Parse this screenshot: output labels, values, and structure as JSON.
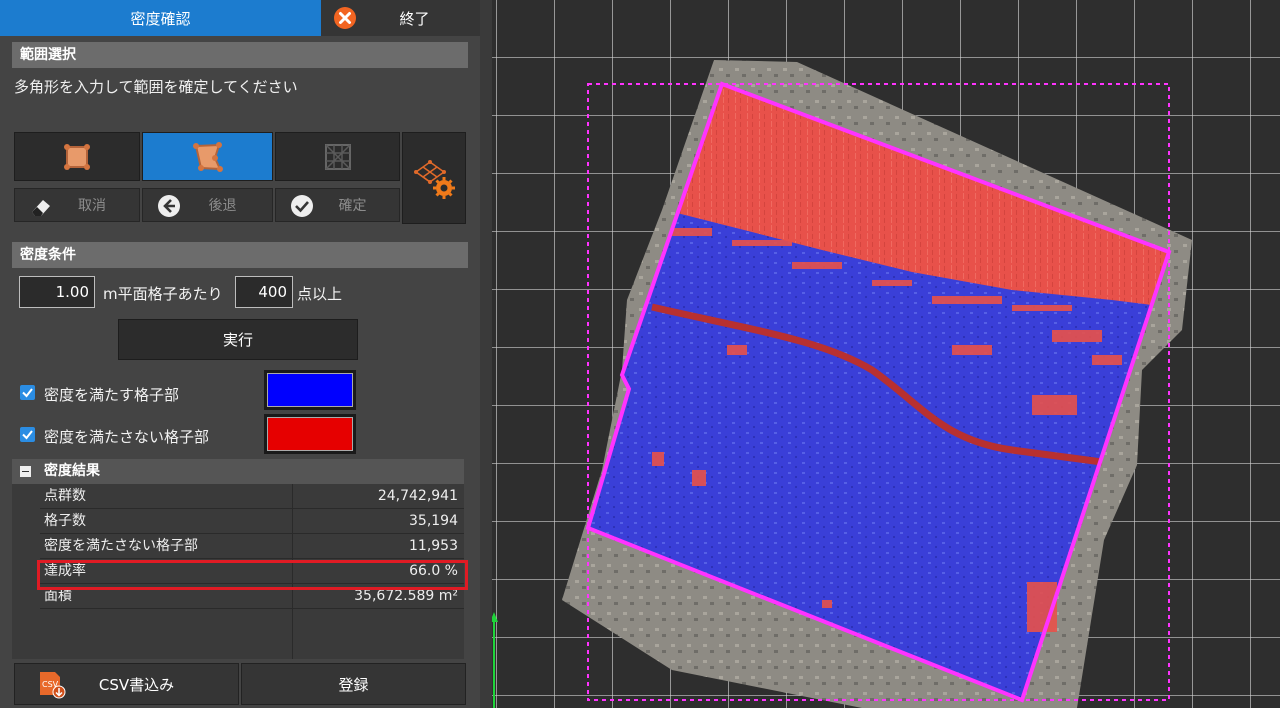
{
  "tabs": {
    "active": "密度確認",
    "close": "終了"
  },
  "range": {
    "title": "範囲選択",
    "instruction": "多角形を入力して範囲を確定してください"
  },
  "actions": {
    "cancel": "取消",
    "back": "後退",
    "confirm": "確定"
  },
  "density": {
    "title": "密度条件",
    "grid_size": "1.00",
    "grid_label": "m平面格子あたり",
    "points": "400",
    "points_label": "点以上",
    "run": "実行",
    "meet_label": "密度を満たす格子部",
    "meet_color": "#0000ff",
    "fail_label": "密度を満たさない格子部",
    "fail_color": "#e60000"
  },
  "results": {
    "title": "密度結果",
    "rows": [
      {
        "key": "点群数",
        "value": "24,742,941"
      },
      {
        "key": "格子数",
        "value": "35,194"
      },
      {
        "key": "密度を満たさない格子部",
        "value": "11,953"
      },
      {
        "key": "達成率",
        "value": "66.0 %"
      },
      {
        "key": "面積",
        "value": "35,672.589 m²"
      }
    ]
  },
  "bottom": {
    "csv": "CSV書込み",
    "register": "登録"
  },
  "icons": {
    "close": "close-circle-icon",
    "csv": "csv-file-icon"
  }
}
